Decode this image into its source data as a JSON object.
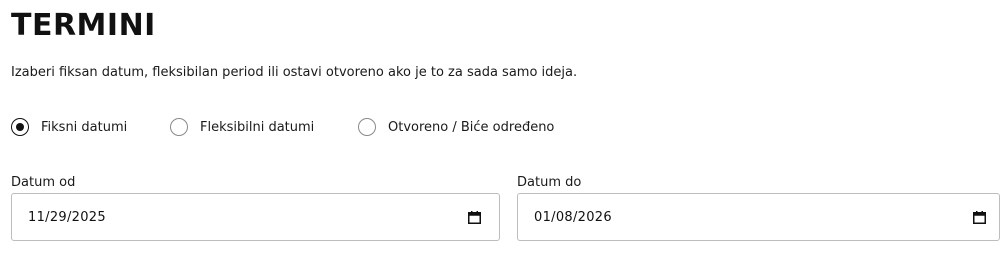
{
  "section": {
    "title": "TERMINI",
    "description": "Izaberi fiksan datum, fleksibilan period ili ostavi otvoreno ako je to za sada samo ideja."
  },
  "date_mode": {
    "options": [
      {
        "label": "Fiksni datumi",
        "checked": true
      },
      {
        "label": "Fleksibilni datumi",
        "checked": false
      },
      {
        "label": "Otvoreno / Biće određeno",
        "checked": false
      }
    ]
  },
  "date_from": {
    "label": "Datum od",
    "value": "11/29/2025",
    "icon": "calendar-icon"
  },
  "date_to": {
    "label": "Datum do",
    "value": "01/08/2026",
    "icon": "calendar-icon"
  }
}
